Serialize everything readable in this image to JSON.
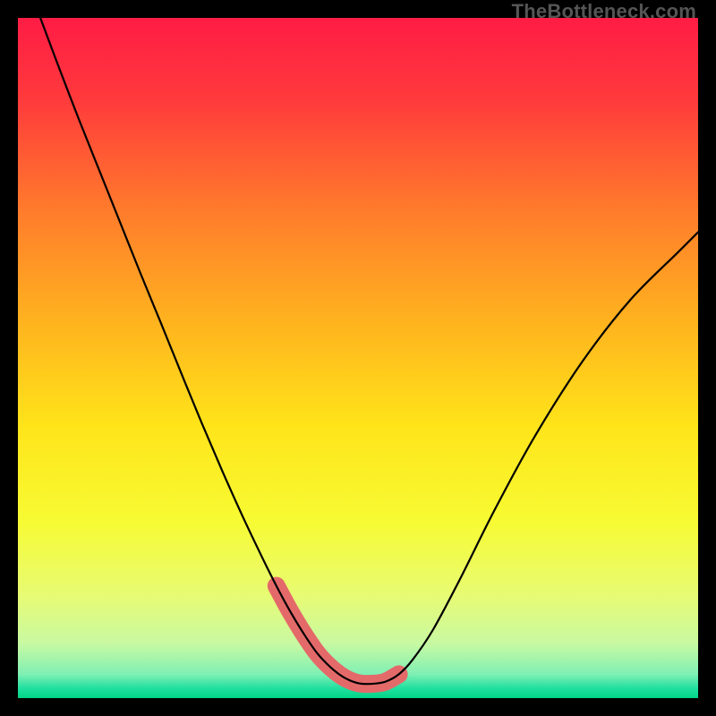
{
  "watermark": "TheBottleneck.com",
  "chart_data": {
    "type": "line",
    "title": "",
    "xlabel": "",
    "ylabel": "",
    "xlim": [
      0,
      1
    ],
    "ylim": [
      0,
      1
    ],
    "gradient_stops": [
      {
        "offset": 0.0,
        "color": "#ff1c45"
      },
      {
        "offset": 0.12,
        "color": "#ff3a3c"
      },
      {
        "offset": 0.28,
        "color": "#ff7a2c"
      },
      {
        "offset": 0.45,
        "color": "#ffb41e"
      },
      {
        "offset": 0.6,
        "color": "#ffe41a"
      },
      {
        "offset": 0.74,
        "color": "#f7fb33"
      },
      {
        "offset": 0.85,
        "color": "#e7fb74"
      },
      {
        "offset": 0.92,
        "color": "#c8f9a2"
      },
      {
        "offset": 0.965,
        "color": "#7ff0b4"
      },
      {
        "offset": 0.985,
        "color": "#22e0a0"
      },
      {
        "offset": 1.0,
        "color": "#00d488"
      }
    ],
    "curve": {
      "x": [
        0.033,
        0.06,
        0.09,
        0.12,
        0.15,
        0.18,
        0.21,
        0.24,
        0.27,
        0.3,
        0.33,
        0.36,
        0.38,
        0.4,
        0.42,
        0.44,
        0.46,
        0.48,
        0.5,
        0.52,
        0.54,
        0.56,
        0.58,
        0.61,
        0.65,
        0.7,
        0.76,
        0.83,
        0.9,
        0.97,
        1.0
      ],
      "y": [
        1.0,
        0.928,
        0.85,
        0.775,
        0.7,
        0.625,
        0.552,
        0.478,
        0.405,
        0.335,
        0.268,
        0.205,
        0.165,
        0.128,
        0.095,
        0.066,
        0.045,
        0.03,
        0.022,
        0.021,
        0.024,
        0.035,
        0.056,
        0.1,
        0.175,
        0.275,
        0.385,
        0.495,
        0.585,
        0.655,
        0.685
      ]
    },
    "highlight_band": {
      "x_start": 0.368,
      "x_end": 0.578,
      "y_threshold": 0.17,
      "color": "#e46a6a",
      "stroke_width": 20
    }
  }
}
